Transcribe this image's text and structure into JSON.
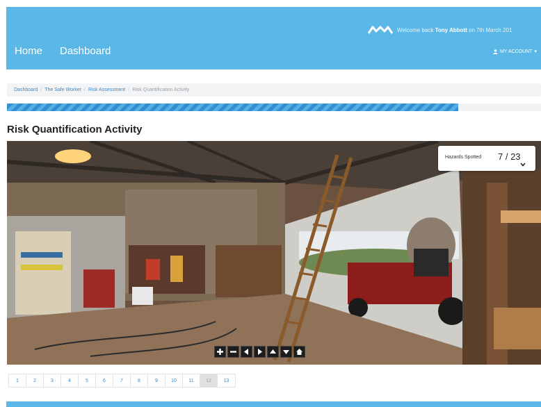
{
  "nav": {
    "home_label": "Home",
    "dashboard_label": "Dashboard"
  },
  "header": {
    "welcome_prefix": "Welcome back",
    "user_name": "Tony Abbott",
    "welcome_suffix": "on 7th March 201",
    "account_label": "MY ACCOUNT"
  },
  "breadcrumb": {
    "items": [
      "Dashboard",
      "The Safe Worker",
      "Risk Assessment"
    ],
    "current": "Risk Quantification Activity"
  },
  "progress": {
    "fraction": 0.845
  },
  "page_title": "Risk Quantification Activity",
  "hazards": {
    "label": "Hazards Spotted",
    "count": "7 / 23"
  },
  "controls": [
    {
      "icon": "zoom-in-icon"
    },
    {
      "icon": "zoom-out-icon"
    },
    {
      "icon": "pan-left-icon"
    },
    {
      "icon": "pan-right-icon"
    },
    {
      "icon": "pan-up-icon"
    },
    {
      "icon": "pan-down-icon"
    },
    {
      "icon": "home-icon"
    }
  ],
  "pagination": {
    "pages": [
      "1",
      "2",
      "3",
      "4",
      "5",
      "6",
      "7",
      "8",
      "9",
      "10",
      "11",
      "12",
      "13"
    ],
    "active": "12"
  },
  "colors": {
    "brand": "#5bb8e6",
    "link": "#3a87c9",
    "progress": "#2f8fd0"
  }
}
